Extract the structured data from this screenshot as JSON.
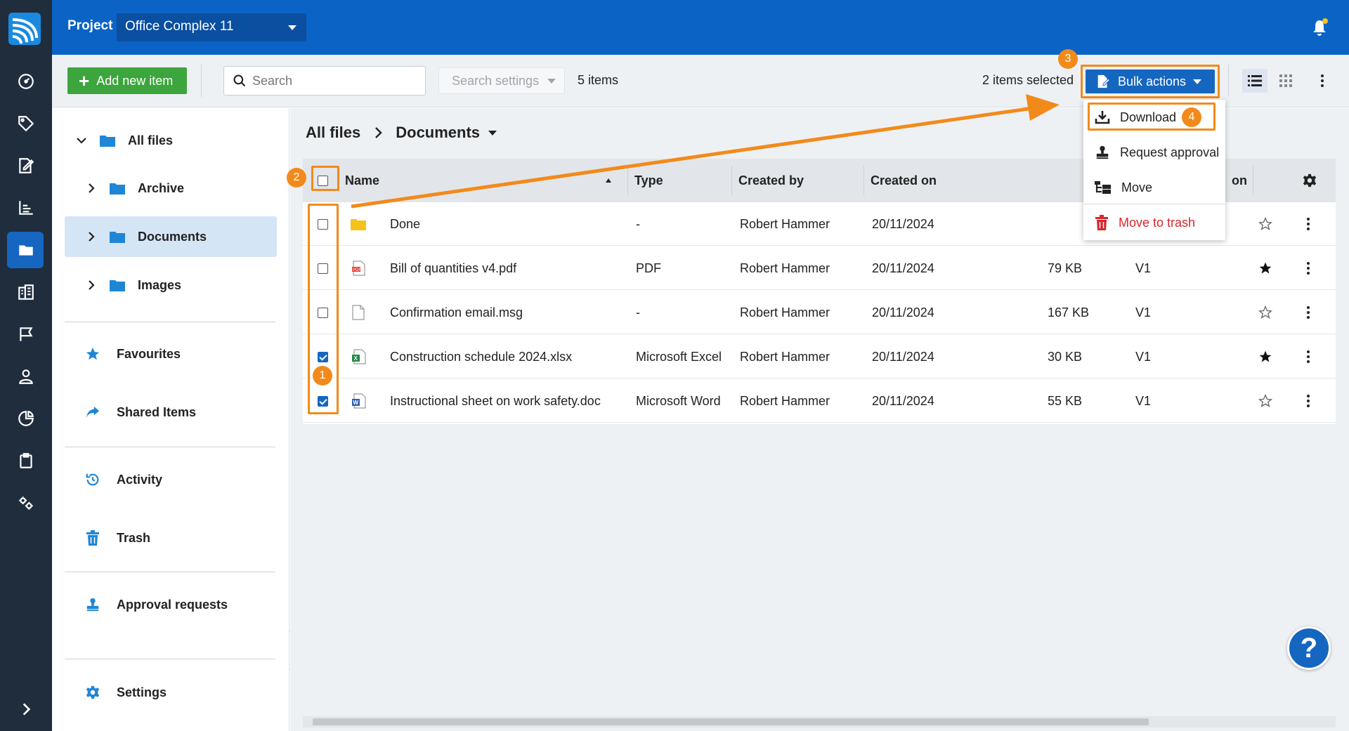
{
  "topbar": {
    "project_label": "Project",
    "project_name": "Office Complex 11"
  },
  "toolbar": {
    "add_label": "Add new item",
    "search_placeholder": "Search",
    "search_settings_label": "Search settings",
    "item_count": "5 items",
    "selected_count": "2 items selected",
    "bulk_label": "Bulk actions"
  },
  "sidebar": {
    "tree": [
      {
        "label": "All files"
      },
      {
        "label": "Archive"
      },
      {
        "label": "Documents"
      },
      {
        "label": "Images"
      }
    ],
    "links": [
      {
        "label": "Favourites"
      },
      {
        "label": "Shared Items"
      },
      {
        "label": "Activity"
      },
      {
        "label": "Trash"
      },
      {
        "label": "Approval requests"
      },
      {
        "label": "Settings"
      }
    ]
  },
  "breadcrumb": {
    "root": "All files",
    "current": "Documents"
  },
  "table": {
    "columns": {
      "name": "Name",
      "type": "Type",
      "created_by": "Created by",
      "created_on": "Created on",
      "version_partial": "on"
    },
    "rows": [
      {
        "name": "Done",
        "type": "-",
        "created_by": "Robert Hammer",
        "created_on": "20/11/2024",
        "size": "",
        "version": "",
        "checked": false,
        "favourite": false,
        "icon": "folder-icon"
      },
      {
        "name": "Bill of quantities v4.pdf",
        "type": "PDF",
        "created_by": "Robert Hammer",
        "created_on": "20/11/2024",
        "size": "79 KB",
        "version": "V1",
        "checked": false,
        "favourite": true,
        "icon": "pdf-file-icon"
      },
      {
        "name": "Confirmation email.msg",
        "type": "-",
        "created_by": "Robert Hammer",
        "created_on": "20/11/2024",
        "size": "167 KB",
        "version": "V1",
        "checked": false,
        "favourite": false,
        "icon": "generic-file-icon"
      },
      {
        "name": "Construction schedule 2024.xlsx",
        "type": "Microsoft Excel",
        "created_by": "Robert Hammer",
        "created_on": "20/11/2024",
        "size": "30 KB",
        "version": "V1",
        "checked": true,
        "favourite": true,
        "icon": "excel-file-icon"
      },
      {
        "name": "Instructional sheet on work safety.doc",
        "type": "Microsoft Word",
        "created_by": "Robert Hammer",
        "created_on": "20/11/2024",
        "size": "55 KB",
        "version": "V1",
        "checked": true,
        "favourite": false,
        "icon": "word-file-icon"
      }
    ]
  },
  "bulk_menu": {
    "download": "Download",
    "request_approval": "Request approval",
    "move": "Move",
    "trash": "Move to trash"
  },
  "annotations": {
    "step1": "1",
    "step2": "2",
    "step3": "3",
    "step4": "4"
  },
  "help_label": "?",
  "colors": {
    "brand_blue": "#0b63c6",
    "button_blue": "#1566c0",
    "add_green": "#3ca53d",
    "annotation_orange": "#f28a1b",
    "danger_red": "#d8262e",
    "rail_dark": "#1f2d3d",
    "folder_blue": "#1f86d6",
    "folder_yellow": "#f6c21c"
  }
}
